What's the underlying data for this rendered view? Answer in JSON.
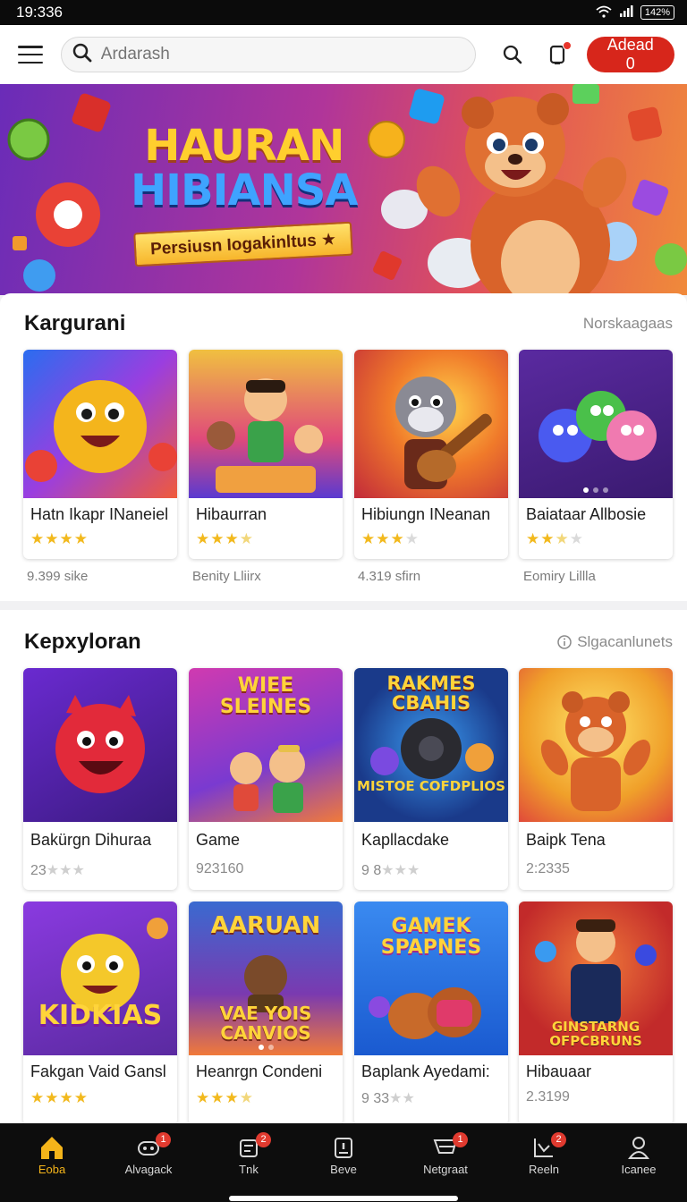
{
  "status": {
    "time": "19:336",
    "battery": "142%"
  },
  "topbar": {
    "search_placeholder": "Ardarash",
    "add_label": "Adead 0"
  },
  "banner": {
    "title_line1": "HAURAN",
    "title_line2": "HIBIANSA",
    "pill_text": "Persiusn Iogakinltus ★"
  },
  "section1": {
    "title": "Kargurani",
    "link": "Norskaagaas",
    "cards": [
      {
        "title": "Hatn Ikapr INaneiel",
        "rating": 4,
        "meta": "9.399 sike"
      },
      {
        "title": "Hibaurran",
        "rating": 3.5,
        "meta": "Benity Lliirx"
      },
      {
        "title": "Hibiungn INeanan",
        "rating": 3,
        "meta": "4.319 sfirn"
      },
      {
        "title": "Baiataar Allbosie",
        "rating": 2.5,
        "meta": "Eomiry Lillla"
      }
    ]
  },
  "section2": {
    "title": "Kepxyloran",
    "link": "Slgacanlunets",
    "row1": [
      {
        "title": "Bakürgn Dihuraa",
        "meta": "23",
        "rating": 1,
        "thumb_text": ""
      },
      {
        "title": "Game",
        "meta": "923160",
        "rating": 0,
        "thumb_text": "WIEE SLEINES"
      },
      {
        "title": "Kapllacdake",
        "meta": "9 8",
        "rating": 1,
        "thumb_text": "RAKMES CBAHIS"
      },
      {
        "title": "Baipk Tena",
        "meta": "2:2335",
        "rating": 0,
        "thumb_text": ""
      }
    ],
    "row2": [
      {
        "title": "Fakgan Vaid Gansl",
        "rating": 4,
        "meta": "",
        "thumb_text": "KIDKIAS"
      },
      {
        "title": "Heanrgn Condeni",
        "rating": 3.5,
        "meta": "",
        "thumb_text": "AARUAN"
      },
      {
        "title": "Baplank Ayedami:",
        "rating": 0,
        "meta": "9 33",
        "thumb_text": "GAMEK SPAPNES"
      },
      {
        "title": "Hibauaar",
        "rating": 0,
        "meta": "2.3199",
        "thumb_text": "GINSTARNG OFPCBRUNS"
      }
    ],
    "thumb_subs": {
      "cbahis_sub": "MISTOE COFDPLIOS",
      "aaruan_sub": "VAE YOIS CANVIOS"
    }
  },
  "bottom_nav": [
    {
      "label": "Eoba",
      "badge": ""
    },
    {
      "label": "Alvagack",
      "badge": "1"
    },
    {
      "label": "Tnk",
      "badge": "2"
    },
    {
      "label": "Beve",
      "badge": ""
    },
    {
      "label": "Netgraat",
      "badge": "1"
    },
    {
      "label": "Reeln",
      "badge": "2"
    },
    {
      "label": "Icanee",
      "badge": ""
    }
  ],
  "colors": {
    "accent_red": "#d7261b",
    "star": "#f2b91d",
    "nav_active": "#f4b41a"
  }
}
